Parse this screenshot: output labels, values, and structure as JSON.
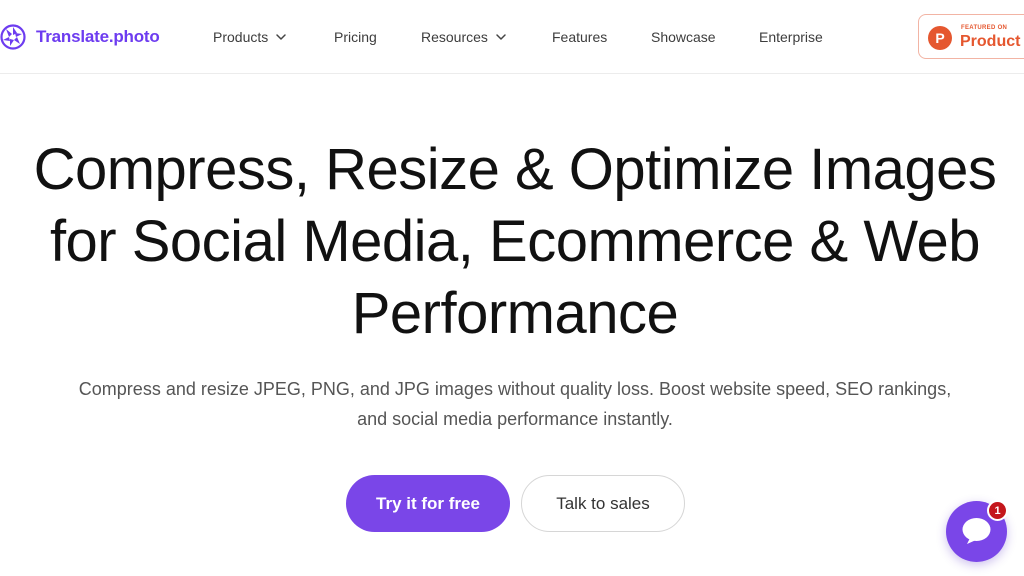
{
  "brand": {
    "name": "Translate.photo",
    "color": "#6d3cf0"
  },
  "nav": {
    "items": [
      {
        "label": "Products",
        "has_dropdown": true
      },
      {
        "label": "Pricing",
        "has_dropdown": false
      },
      {
        "label": "Resources",
        "has_dropdown": true
      },
      {
        "label": "Features",
        "has_dropdown": false
      },
      {
        "label": "Showcase",
        "has_dropdown": false
      },
      {
        "label": "Enterprise",
        "has_dropdown": false
      }
    ]
  },
  "product_hunt": {
    "featured": "FEATURED ON",
    "name": "Product Hunt",
    "logo_letter": "P",
    "color": "#e5572f"
  },
  "hero": {
    "title_lines": [
      "Compress, Resize & Optimize Images",
      "for Social Media, Ecommerce & Web",
      "Performance"
    ],
    "subtitle_lines": [
      "Compress and resize JPEG, PNG, and JPG images without quality loss. Boost website speed, SEO rankings,",
      "and social media performance instantly."
    ],
    "primary_cta": "Try it for free",
    "secondary_cta": "Talk to sales",
    "accent": "#7a46e8"
  },
  "chat": {
    "icon": "chat-bubble-icon",
    "unread_count": "1"
  }
}
